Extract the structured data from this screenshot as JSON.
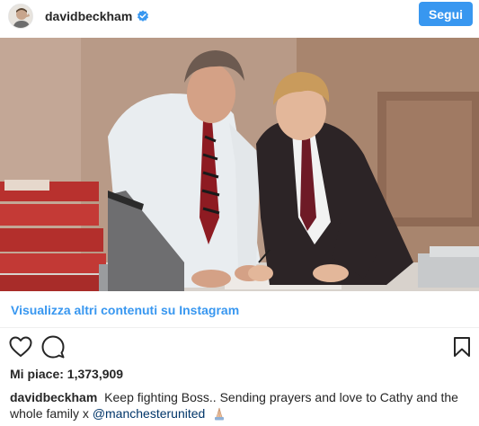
{
  "header": {
    "username": "davidbeckham",
    "verified_icon": "verified-badge-icon",
    "follow_label": "Segui"
  },
  "post": {
    "more_link": "Visualizza altri contenuti su Instagram",
    "likes_label": "Mi piace: 1,373,909",
    "caption_user": "davidbeckham",
    "caption_text": "Keep fighting Boss.. Sending prayers and love to Cathy and the whole family x",
    "caption_mention": "@manchesterunited",
    "caption_emoji": "praying-hands-emoji"
  },
  "icons": {
    "like": "heart-icon",
    "comment": "comment-icon",
    "save": "bookmark-icon"
  },
  "colors": {
    "accent": "#3897f0",
    "text": "#262626",
    "mention": "#003569"
  }
}
